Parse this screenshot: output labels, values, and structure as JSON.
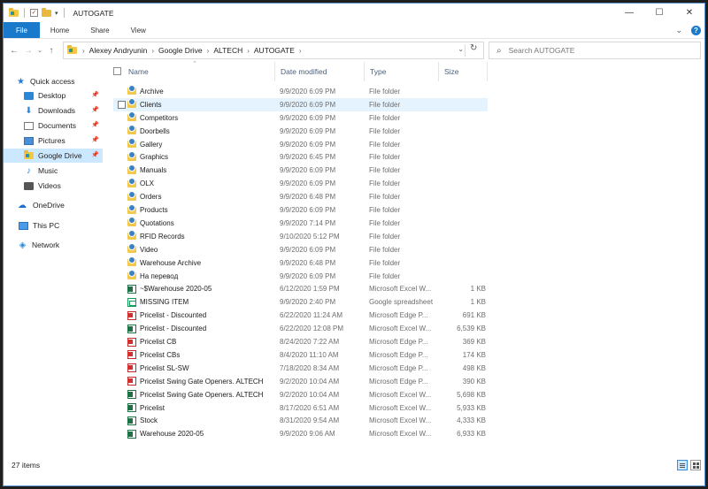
{
  "window": {
    "title": "AUTOGATE"
  },
  "ribbon": {
    "tabs": [
      "File",
      "Home",
      "Share",
      "View"
    ]
  },
  "address": {
    "crumbs": [
      "Alexey Andryunin",
      "Google Drive",
      "ALTECH",
      "AUTOGATE"
    ]
  },
  "search": {
    "placeholder": "Search AUTOGATE"
  },
  "nav": {
    "items": [
      {
        "label": "Quick access",
        "icon": "star-icon"
      },
      {
        "label": "Desktop",
        "icon": "desktop-folder-icon",
        "pinned": true
      },
      {
        "label": "Downloads",
        "icon": "download-icon",
        "pinned": true
      },
      {
        "label": "Documents",
        "icon": "documents-icon",
        "pinned": true
      },
      {
        "label": "Pictures",
        "icon": "pictures-icon",
        "pinned": true
      },
      {
        "label": "Google Drive",
        "icon": "google-drive-icon",
        "pinned": true,
        "selected": true
      },
      {
        "label": "Music",
        "icon": "music-icon"
      },
      {
        "label": "Videos",
        "icon": "videos-icon"
      },
      {
        "label": "OneDrive",
        "icon": "onedrive-cloud-icon"
      },
      {
        "label": "This PC",
        "icon": "computer-icon"
      },
      {
        "label": "Network",
        "icon": "network-icon"
      }
    ]
  },
  "columns": {
    "name": "Name",
    "date": "Date modified",
    "type": "Type",
    "size": "Size"
  },
  "files": [
    {
      "name": "Archive",
      "date": "9/9/2020 6:09 PM",
      "type": "File folder",
      "size": "",
      "icon": "folder"
    },
    {
      "name": "Clients",
      "date": "9/9/2020 6:09 PM",
      "type": "File folder",
      "size": "",
      "icon": "folder"
    },
    {
      "name": "Competitors",
      "date": "9/9/2020 6:09 PM",
      "type": "File folder",
      "size": "",
      "icon": "folder"
    },
    {
      "name": "Doorbells",
      "date": "9/9/2020 6:09 PM",
      "type": "File folder",
      "size": "",
      "icon": "folder"
    },
    {
      "name": "Gallery",
      "date": "9/9/2020 6:09 PM",
      "type": "File folder",
      "size": "",
      "icon": "folder"
    },
    {
      "name": "Graphics",
      "date": "9/9/2020 6:45 PM",
      "type": "File folder",
      "size": "",
      "icon": "folder"
    },
    {
      "name": "Manuals",
      "date": "9/9/2020 6:09 PM",
      "type": "File folder",
      "size": "",
      "icon": "folder"
    },
    {
      "name": "OLX",
      "date": "9/9/2020 6:09 PM",
      "type": "File folder",
      "size": "",
      "icon": "folder"
    },
    {
      "name": "Orders",
      "date": "9/9/2020 6:48 PM",
      "type": "File folder",
      "size": "",
      "icon": "folder"
    },
    {
      "name": "Products",
      "date": "9/9/2020 6:09 PM",
      "type": "File folder",
      "size": "",
      "icon": "folder"
    },
    {
      "name": "Quotations",
      "date": "9/9/2020 7:14 PM",
      "type": "File folder",
      "size": "",
      "icon": "folder"
    },
    {
      "name": "RFID Records",
      "date": "9/10/2020 5:12 PM",
      "type": "File folder",
      "size": "",
      "icon": "folder"
    },
    {
      "name": "Video",
      "date": "9/9/2020 6:09 PM",
      "type": "File folder",
      "size": "",
      "icon": "folder"
    },
    {
      "name": "Warehouse Archive",
      "date": "9/9/2020 6:48 PM",
      "type": "File folder",
      "size": "",
      "icon": "folder"
    },
    {
      "name": "На перевод",
      "date": "9/9/2020 6:09 PM",
      "type": "File folder",
      "size": "",
      "icon": "folder"
    },
    {
      "name": "~$Warehouse 2020-05",
      "date": "6/12/2020 1:59 PM",
      "type": "Microsoft Excel W...",
      "size": "1 KB",
      "icon": "excel"
    },
    {
      "name": "MISSING ITEM",
      "date": "9/9/2020 2:40 PM",
      "type": "Google spreadsheet",
      "size": "1 KB",
      "icon": "sheet"
    },
    {
      "name": "Pricelist - Discounted",
      "date": "6/22/2020 11:24 AM",
      "type": "Microsoft Edge P...",
      "size": "691 KB",
      "icon": "pdf"
    },
    {
      "name": "Pricelist - Discounted",
      "date": "6/22/2020 12:08 PM",
      "type": "Microsoft Excel W...",
      "size": "6,539 KB",
      "icon": "excel"
    },
    {
      "name": "Pricelist CB",
      "date": "8/24/2020 7:22 AM",
      "type": "Microsoft Edge P...",
      "size": "369 KB",
      "icon": "pdf"
    },
    {
      "name": "Pricelist CBs",
      "date": "8/4/2020 11:10 AM",
      "type": "Microsoft Edge P...",
      "size": "174 KB",
      "icon": "pdf"
    },
    {
      "name": "Pricelist SL-SW",
      "date": "7/18/2020 8:34 AM",
      "type": "Microsoft Edge P...",
      "size": "498 KB",
      "icon": "pdf"
    },
    {
      "name": "Pricelist Swing Gate Openers. ALTECH",
      "date": "9/2/2020 10:04 AM",
      "type": "Microsoft Edge P...",
      "size": "390 KB",
      "icon": "pdf"
    },
    {
      "name": "Pricelist Swing Gate Openers. ALTECH",
      "date": "9/2/2020 10:04 AM",
      "type": "Microsoft Excel W...",
      "size": "5,698 KB",
      "icon": "excel"
    },
    {
      "name": "Pricelist",
      "date": "8/17/2020 6:51 AM",
      "type": "Microsoft Excel W...",
      "size": "5,933 KB",
      "icon": "excel"
    },
    {
      "name": "Stock",
      "date": "8/31/2020 9:54 AM",
      "type": "Microsoft Excel W...",
      "size": "4,333 KB",
      "icon": "excel"
    },
    {
      "name": "Warehouse 2020-05",
      "date": "9/9/2020 9:06 AM",
      "type": "Microsoft Excel W...",
      "size": "6,933 KB",
      "icon": "excel"
    }
  ],
  "status": {
    "count": "27 items"
  }
}
